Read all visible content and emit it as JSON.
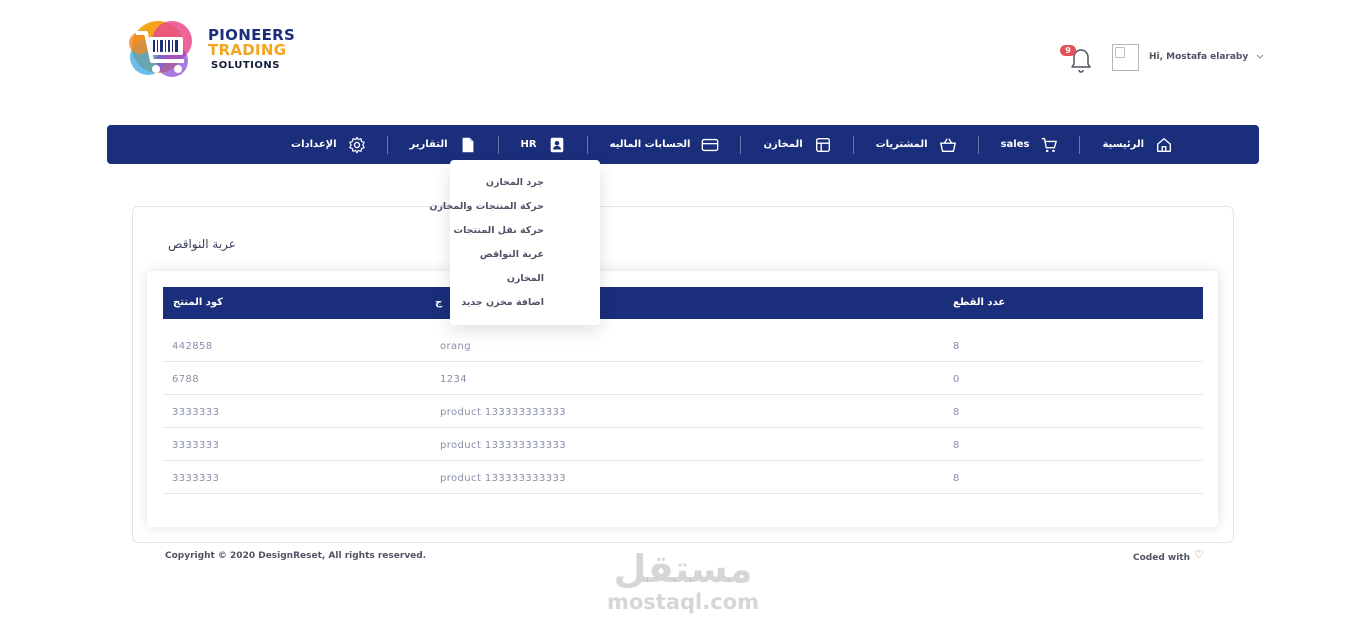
{
  "brand": {
    "line1_part1": "PIONEERS",
    "line1_part2": "TRADING",
    "line2": "SOLUTIONS",
    "primary": "#1b2e7b",
    "accent": "#f4a51c"
  },
  "header": {
    "notification_count": "9",
    "user_greeting": "Hi, Mostafa elaraby"
  },
  "nav": {
    "items": [
      {
        "label": "الرئيسية",
        "icon": "home-icon"
      },
      {
        "label": "sales",
        "icon": "cart-icon"
      },
      {
        "label": "المشتريات",
        "icon": "basket-icon"
      },
      {
        "label": "المخازن",
        "icon": "layout-icon"
      },
      {
        "label": "الحسابات الماليه",
        "icon": "credit-card-icon"
      },
      {
        "label": "HR",
        "icon": "contact-icon"
      },
      {
        "label": "التقارير",
        "icon": "file-icon"
      },
      {
        "label": "الإعدادات",
        "icon": "gear-icon"
      }
    ]
  },
  "dropdown": {
    "items": [
      "جرد المخازن",
      "حركة المنتجات والمخازن",
      "حركة نقل المنتجات",
      "عربة النواقص",
      "المخازن",
      "اضافة مخزن جديد"
    ]
  },
  "main": {
    "title": "عربة النواقص",
    "table": {
      "headers": [
        "كود المنتج",
        "ج",
        "عدد القطع"
      ],
      "rows": [
        [
          "442858",
          "orang",
          "8"
        ],
        [
          "6788",
          "1234",
          "0"
        ],
        [
          "3333333",
          "product 133333333333",
          "8"
        ],
        [
          "3333333",
          "product 133333333333",
          "8"
        ],
        [
          "3333333",
          "product 133333333333",
          "8"
        ]
      ]
    }
  },
  "footer": {
    "copyright": "Copyright © 2020 DesignReset, All rights reserved.",
    "coded_with": "Coded with"
  },
  "watermark": {
    "arabic": "مستقل",
    "latin": "mostaql.com"
  }
}
